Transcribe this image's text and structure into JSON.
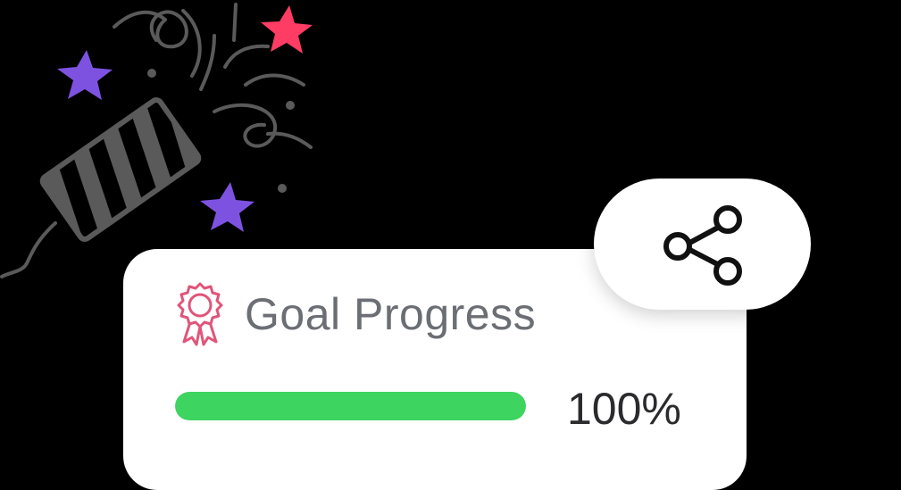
{
  "card": {
    "title": "Goal Progress",
    "progress_percent_label": "100%",
    "progress_value": 1.0,
    "award_icon": "award-ribbon-icon",
    "accent_color": "#e0557a",
    "progress_color": "#3dd45f"
  },
  "share": {
    "icon": "share-icon"
  },
  "decoration": {
    "icons": [
      "party-popper-icon",
      "star-icon",
      "confetti-icon"
    ],
    "star_colors": [
      "#ff3c64",
      "#7d52e0"
    ],
    "popper_color": "#5a5a5a"
  }
}
